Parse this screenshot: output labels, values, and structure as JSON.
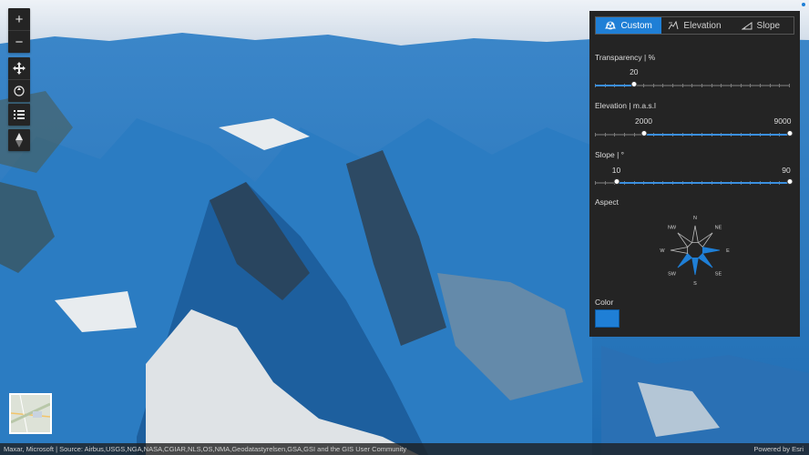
{
  "map": {
    "attribution": "Maxar, Microsoft | Source: Airbus,USGS,NGA,NASA,CGIAR,NLS,OS,NMA,Geodatastyrelsen,GSA,GSI and the GIS User Community",
    "powered_by": "Powered by Esri"
  },
  "controls": {
    "zoom_in": "+",
    "zoom_out": "−"
  },
  "panel": {
    "tabs": [
      {
        "label": "Custom",
        "active": true
      },
      {
        "label": "Elevation",
        "active": false
      },
      {
        "label": "Slope",
        "active": false
      }
    ],
    "transparency": {
      "label": "Transparency | %",
      "value": "20",
      "fraction": 0.2
    },
    "elevation": {
      "label": "Elevation | m.a.s.l",
      "min_value": "2000",
      "max_value": "9000",
      "min_fraction": 0.25,
      "max_fraction": 1.0
    },
    "slope": {
      "label": "Slope | °",
      "min_value": "10",
      "max_value": "90",
      "min_fraction": 0.11,
      "max_fraction": 1.0
    },
    "aspect": {
      "label": "Aspect",
      "directions": [
        "N",
        "NE",
        "E",
        "SE",
        "S",
        "SW",
        "W",
        "NW"
      ],
      "selected": [
        "E",
        "SE",
        "S",
        "SW"
      ]
    },
    "color": {
      "label": "Color",
      "value": "#1f7fd6"
    }
  }
}
